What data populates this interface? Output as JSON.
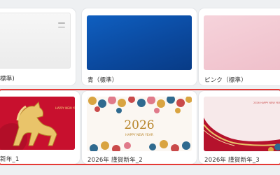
{
  "templates": [
    {
      "label": "標準)",
      "color": "#f4f4f4"
    },
    {
      "label": "青（標準）",
      "color": "#1353a8"
    },
    {
      "label": "ピンク（標準）",
      "color": "#f3cbd4"
    },
    {
      "label": "新年_1",
      "color": "#c8102e"
    },
    {
      "label": "2026年 謹賀新年_2",
      "color": "#fbf7f2"
    },
    {
      "label": "2026年 謹賀新年_3",
      "color": "#f7e9ea"
    }
  ],
  "card5": {
    "year": "2026",
    "greeting": "HAPPY NEW YEAR"
  },
  "selection_color": "#e53935"
}
